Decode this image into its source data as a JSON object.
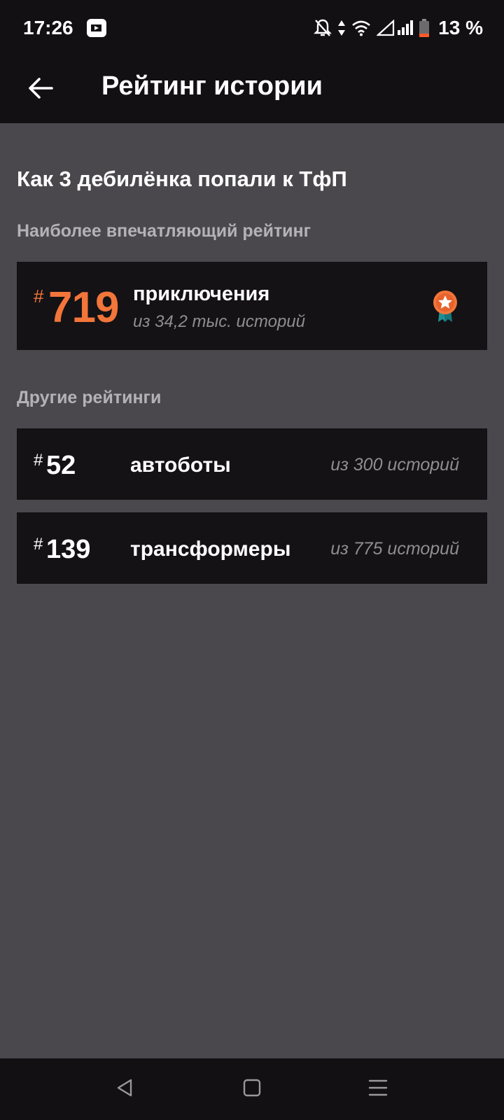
{
  "status_bar": {
    "time": "17:26",
    "app_icon": "video-play-icon",
    "icons": [
      "notifications-off-icon",
      "data-transfer-icon",
      "wifi-icon",
      "signal-icon",
      "battery-icon"
    ],
    "battery": "13 %"
  },
  "app_bar": {
    "back_icon": "arrow-back-icon",
    "title": "Рейтинг истории"
  },
  "story": {
    "title": "Как 3 дебилёнка попали к ТфП"
  },
  "top_rating": {
    "label": "Наиболее впечатляющий рейтинг",
    "hash": "#",
    "rank": "719",
    "tag": "приключения",
    "count": "из 34,2 тыс. историй",
    "badge_icon": "award-ribbon-icon",
    "accent_color": "#f2753a"
  },
  "other_ratings": {
    "label": "Другие рейтинги",
    "items": [
      {
        "hash": "#",
        "rank": "52",
        "tag": "автоботы",
        "count": "из 300 историй"
      },
      {
        "hash": "#",
        "rank": "139",
        "tag": "трансформеры",
        "count": "из 775 историй"
      }
    ]
  },
  "nav_bar": {
    "buttons": [
      "back-triangle-icon",
      "home-square-icon",
      "recents-menu-icon"
    ]
  }
}
